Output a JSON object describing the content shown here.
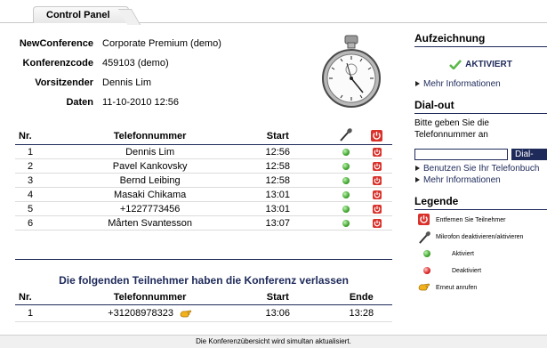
{
  "tab": {
    "label": "Control Panel"
  },
  "info": {
    "rows": [
      {
        "label": "NewConference",
        "value": "Corporate Premium (demo)"
      },
      {
        "label": "Konferenzcode",
        "value": "459103 (demo)"
      },
      {
        "label": "Vorsitzender",
        "value": "Dennis Lim"
      },
      {
        "label": "Daten",
        "value": "11-10-2010 12:56"
      }
    ]
  },
  "participants": {
    "headers": {
      "nr": "Nr.",
      "phone": "Telefonnummer",
      "start": "Start"
    },
    "rows": [
      {
        "nr": "1",
        "phone": "Dennis Lim",
        "start": "12:56"
      },
      {
        "nr": "2",
        "phone": "Pavel Kankovsky",
        "start": "12:58"
      },
      {
        "nr": "3",
        "phone": "Bernd Leibing",
        "start": "12:58"
      },
      {
        "nr": "4",
        "phone": "Masaki Chikama",
        "start": "13:01"
      },
      {
        "nr": "5",
        "phone": "+1227773456",
        "start": "13:01"
      },
      {
        "nr": "6",
        "phone": "Mårten Svantesson",
        "start": "13:07"
      }
    ]
  },
  "left_participants": {
    "title": "Die folgenden Teilnehmer haben die Konferenz verlassen",
    "headers": {
      "nr": "Nr.",
      "phone": "Telefonnummer",
      "start": "Start",
      "end": "Ende"
    },
    "rows": [
      {
        "nr": "1",
        "phone": "+31208978323",
        "start": "13:06",
        "end": "13:28"
      }
    ]
  },
  "sidebar": {
    "recording": {
      "title": "Aufzeichnung",
      "status": "AKTIVIERT",
      "more": "Mehr Informationen"
    },
    "dialout": {
      "title": "Dial-out",
      "text": "Bitte geben Sie die Telefonnummer an",
      "input_value": "",
      "button": "Dial-out",
      "links": [
        "Benutzen Sie Ihr Telefonbuch",
        "Mehr Informationen"
      ]
    },
    "legend": {
      "title": "Legende",
      "items": [
        {
          "icon": "power-icon",
          "text": "Entfernen Sie Teilnehmer"
        },
        {
          "icon": "microphone-icon",
          "text": "Mikrofon deaktivieren/aktivieren"
        },
        {
          "icon": "green-dot-icon",
          "text": "Aktiviert"
        },
        {
          "icon": "red-dot-icon",
          "text": "Deaktiviert"
        },
        {
          "icon": "redial-hand-icon",
          "text": "Erneut anrufen"
        }
      ]
    }
  },
  "footer": {
    "text": "Die Konferenzübersicht wird simultan aktualisiert."
  },
  "colors": {
    "navy": "#1e2a5a",
    "power_red": "#d9312b",
    "active_green": "#3fa52c"
  }
}
